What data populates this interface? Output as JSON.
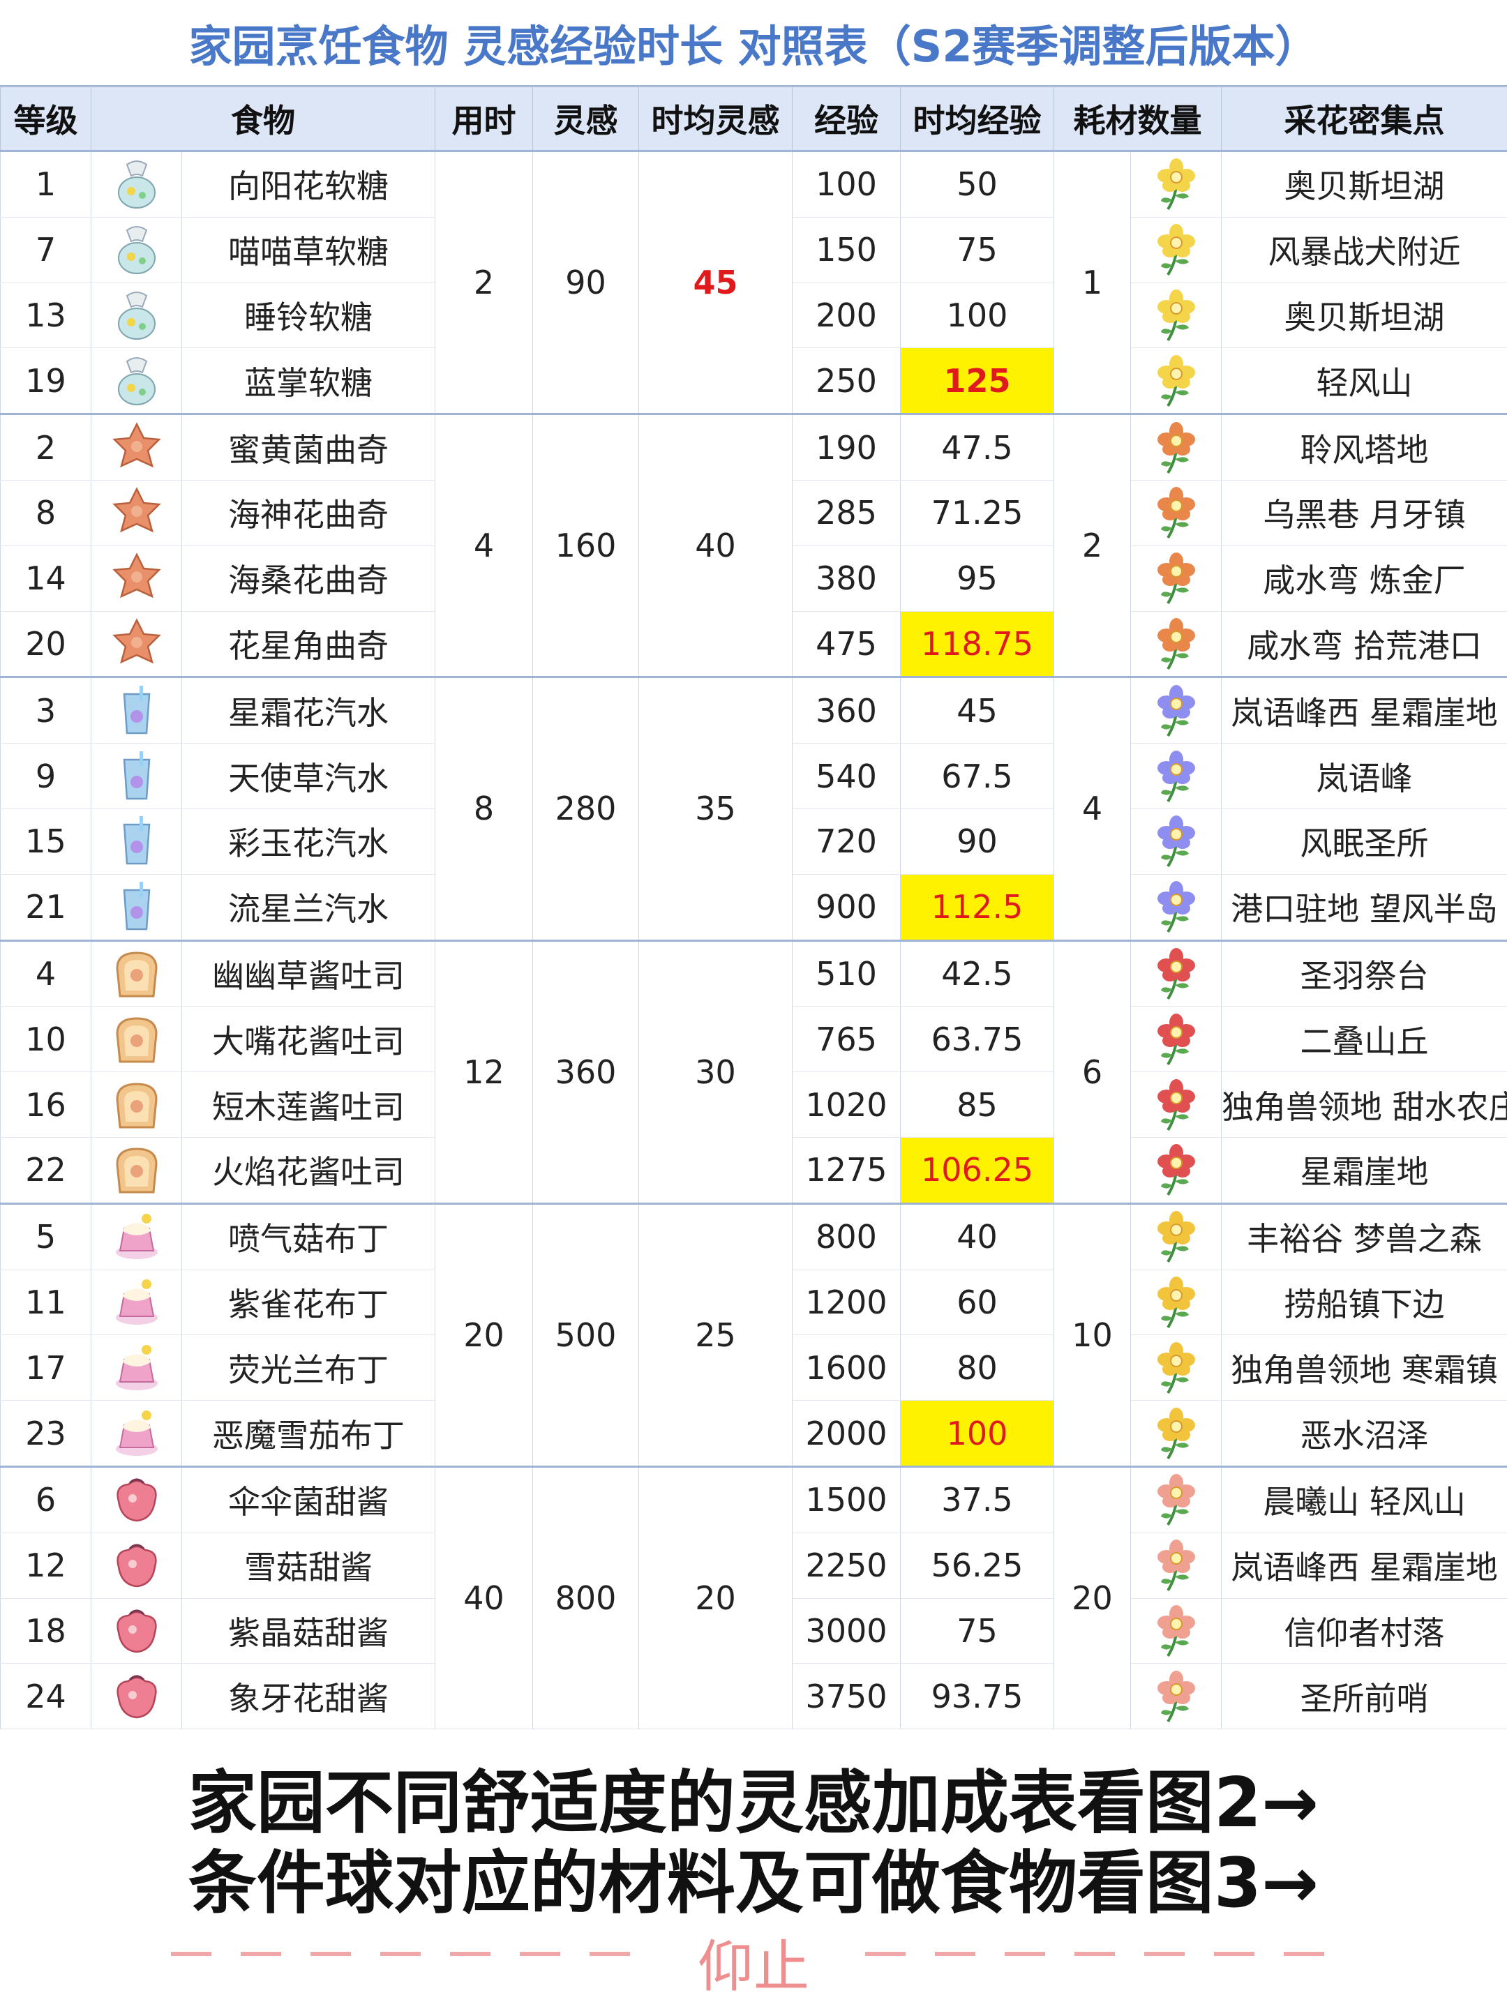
{
  "title": "家园烹饪食物 灵感经验时长 对照表（S2赛季调整后版本）",
  "headers": {
    "level": "等级",
    "food": "食物",
    "time": "用时",
    "inspiration": "灵感",
    "hourly_inspiration": "时均灵感",
    "exp": "经验",
    "hourly_exp": "时均经验",
    "material_count": "耗材数量",
    "flower_spot": "采花密集点"
  },
  "groups": [
    {
      "time": "2",
      "inspiration": "90",
      "hourly_inspiration": "45",
      "material_count": "1",
      "food_icon_color": "#c9e6e8",
      "flower_color": "#f4d54a",
      "rows": [
        {
          "level": "1",
          "food": "向阳花软糖",
          "exp": "100",
          "hourly_exp": "50",
          "spot": "奥贝斯坦湖",
          "food_icon": "candy-bag-icon",
          "flower_icon": "sunflower-icon"
        },
        {
          "level": "7",
          "food": "喵喵草软糖",
          "exp": "150",
          "hourly_exp": "75",
          "spot": "风暴战犬附近",
          "food_icon": "candy-bag-icon",
          "flower_icon": "meow-grass-icon"
        },
        {
          "level": "13",
          "food": "睡铃软糖",
          "exp": "200",
          "hourly_exp": "100",
          "spot": "奥贝斯坦湖",
          "food_icon": "candy-bag-icon",
          "flower_icon": "bellflower-icon"
        },
        {
          "level": "19",
          "food": "蓝掌软糖",
          "exp": "250",
          "hourly_exp": "125",
          "spot": "轻风山",
          "food_icon": "candy-bag-icon",
          "flower_icon": "calla-icon"
        }
      ]
    },
    {
      "time": "4",
      "inspiration": "160",
      "hourly_inspiration": "40",
      "material_count": "2",
      "food_icon_color": "#e9906a",
      "flower_color": "#e9864a",
      "rows": [
        {
          "level": "2",
          "food": "蜜黄菌曲奇",
          "exp": "190",
          "hourly_exp": "47.5",
          "spot": "聆风塔地",
          "food_icon": "cookie-icon",
          "flower_icon": "mushroom-flower-icon"
        },
        {
          "level": "8",
          "food": "海神花曲奇",
          "exp": "285",
          "hourly_exp": "71.25",
          "spot": "乌黑巷 月牙镇",
          "food_icon": "cookie-icon",
          "flower_icon": "red-flower-icon"
        },
        {
          "level": "14",
          "food": "海桑花曲奇",
          "exp": "380",
          "hourly_exp": "95",
          "spot": "咸水弯 炼金厂",
          "food_icon": "cookie-icon",
          "flower_icon": "purple-flower-icon"
        },
        {
          "level": "20",
          "food": "花星角曲奇",
          "exp": "475",
          "hourly_exp": "118.75",
          "spot": "咸水弯 拾荒港口",
          "food_icon": "cookie-icon",
          "flower_icon": "star-flower-icon"
        }
      ]
    },
    {
      "time": "8",
      "inspiration": "280",
      "hourly_inspiration": "35",
      "material_count": "4",
      "food_icon_color": "#aad3f0",
      "flower_color": "#8e8ef0",
      "rows": [
        {
          "level": "3",
          "food": "星霜花汽水",
          "exp": "360",
          "hourly_exp": "45",
          "spot": "岚语峰西 星霜崖地",
          "food_icon": "soda-icon",
          "flower_icon": "frost-flower-icon"
        },
        {
          "level": "9",
          "food": "天使草汽水",
          "exp": "540",
          "hourly_exp": "67.5",
          "spot": "岚语峰",
          "food_icon": "soda-icon",
          "flower_icon": "angel-grass-icon"
        },
        {
          "level": "15",
          "food": "彩玉花汽水",
          "exp": "720",
          "hourly_exp": "90",
          "spot": "风眠圣所",
          "food_icon": "soda-icon",
          "flower_icon": "jade-flower-icon"
        },
        {
          "level": "21",
          "food": "流星兰汽水",
          "exp": "900",
          "hourly_exp": "112.5",
          "spot": "港口驻地 望风半岛",
          "food_icon": "soda-icon",
          "flower_icon": "orchid-icon"
        }
      ]
    },
    {
      "time": "12",
      "inspiration": "360",
      "hourly_inspiration": "30",
      "material_count": "6",
      "food_icon_color": "#f2c58c",
      "flower_color": "#e05050",
      "rows": [
        {
          "level": "4",
          "food": "幽幽草酱吐司",
          "exp": "510",
          "hourly_exp": "42.5",
          "spot": "圣羽祭台",
          "food_icon": "toast-icon",
          "flower_icon": "ghost-grass-icon"
        },
        {
          "level": "10",
          "food": "大嘴花酱吐司",
          "exp": "765",
          "hourly_exp": "63.75",
          "spot": "二叠山丘",
          "food_icon": "toast-icon",
          "flower_icon": "bigmouth-flower-icon"
        },
        {
          "level": "16",
          "food": "短木莲酱吐司",
          "exp": "1020",
          "hourly_exp": "85",
          "spot": "独角兽领地 甜水农庄",
          "food_icon": "toast-icon",
          "flower_icon": "lotus-icon"
        },
        {
          "level": "22",
          "food": "火焰花酱吐司",
          "exp": "1275",
          "hourly_exp": "106.25",
          "spot": "星霜崖地",
          "food_icon": "toast-icon",
          "flower_icon": "flame-flower-icon"
        }
      ]
    },
    {
      "time": "20",
      "inspiration": "500",
      "hourly_inspiration": "25",
      "material_count": "10",
      "food_icon_color": "#f0a3c8",
      "flower_color": "#f2c43c",
      "rows": [
        {
          "level": "5",
          "food": "喷气菇布丁",
          "exp": "800",
          "hourly_exp": "40",
          "spot": "丰裕谷 梦兽之森",
          "food_icon": "pudding-icon",
          "flower_icon": "puff-mushroom-icon"
        },
        {
          "level": "11",
          "food": "紫雀花布丁",
          "exp": "1200",
          "hourly_exp": "60",
          "spot": "捞船镇下边",
          "food_icon": "pudding-icon",
          "flower_icon": "sparrow-flower-icon"
        },
        {
          "level": "17",
          "food": "荧光兰布丁",
          "exp": "1600",
          "hourly_exp": "80",
          "spot": "独角兽领地 寒霜镇",
          "food_icon": "pudding-icon",
          "flower_icon": "glow-orchid-icon"
        },
        {
          "level": "23",
          "food": "恶魔雪茄布丁",
          "exp": "2000",
          "hourly_exp": "100",
          "spot": "恶水沼泽",
          "food_icon": "pudding-icon",
          "flower_icon": "devil-flower-icon"
        }
      ]
    },
    {
      "time": "40",
      "inspiration": "800",
      "hourly_inspiration": "20",
      "material_count": "20",
      "food_icon_color": "#ee7f92",
      "flower_color": "#f0a090",
      "rows": [
        {
          "level": "6",
          "food": "伞伞菌甜酱",
          "exp": "1500",
          "hourly_exp": "37.5",
          "spot": "晨曦山 轻风山",
          "food_icon": "jam-icon",
          "flower_icon": "umbrella-mushroom-icon"
        },
        {
          "level": "12",
          "food": "雪菇甜酱",
          "exp": "2250",
          "hourly_exp": "56.25",
          "spot": "岚语峰西 星霜崖地",
          "food_icon": "jam-icon",
          "flower_icon": "snow-mushroom-icon"
        },
        {
          "level": "18",
          "food": "紫晶菇甜酱",
          "exp": "3000",
          "hourly_exp": "75",
          "spot": "信仰者村落",
          "food_icon": "jam-icon",
          "flower_icon": "amethyst-mushroom-icon"
        },
        {
          "level": "24",
          "food": "象牙花甜酱",
          "exp": "3750",
          "hourly_exp": "93.75",
          "spot": "圣所前哨",
          "food_icon": "jam-icon",
          "flower_icon": "ivory-flower-icon"
        }
      ]
    }
  ],
  "footer": {
    "line1": "家园不同舒适度的灵感加成表看图2→",
    "line2": "条件球对应的材料及可做食物看图3→",
    "signature": "仰止"
  }
}
